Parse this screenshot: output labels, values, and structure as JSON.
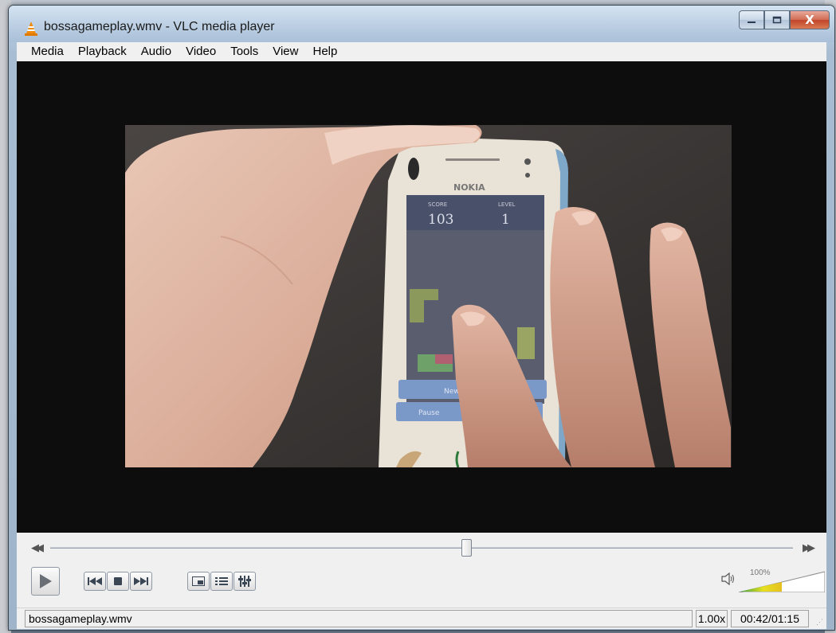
{
  "window": {
    "title": "bossagameplay.wmv - VLC media player",
    "close_glyph": "X"
  },
  "menu": [
    "Media",
    "Playback",
    "Audio",
    "Video",
    "Tools",
    "View",
    "Help"
  ],
  "video": {
    "score_label": "SCORE",
    "score_value": "103",
    "level_label": "LEVEL",
    "level_value": "1",
    "phone_brand": "NOKIA",
    "new_button": "New",
    "pause_button": "Pause"
  },
  "playback": {
    "progress": 0.56,
    "volume_percent": "100%",
    "volume_level": 1.0
  },
  "icons": {
    "play": "play-icon",
    "prev": "previous-icon",
    "stop": "stop-icon",
    "next": "next-icon",
    "fullscreen": "fullscreen-icon",
    "playlist": "playlist-icon",
    "equalizer": "equalizer-icon",
    "speaker": "speaker-icon"
  },
  "status": {
    "filename": "bossagameplay.wmv",
    "speed": "1.00x",
    "time": "00:42/01:15"
  }
}
